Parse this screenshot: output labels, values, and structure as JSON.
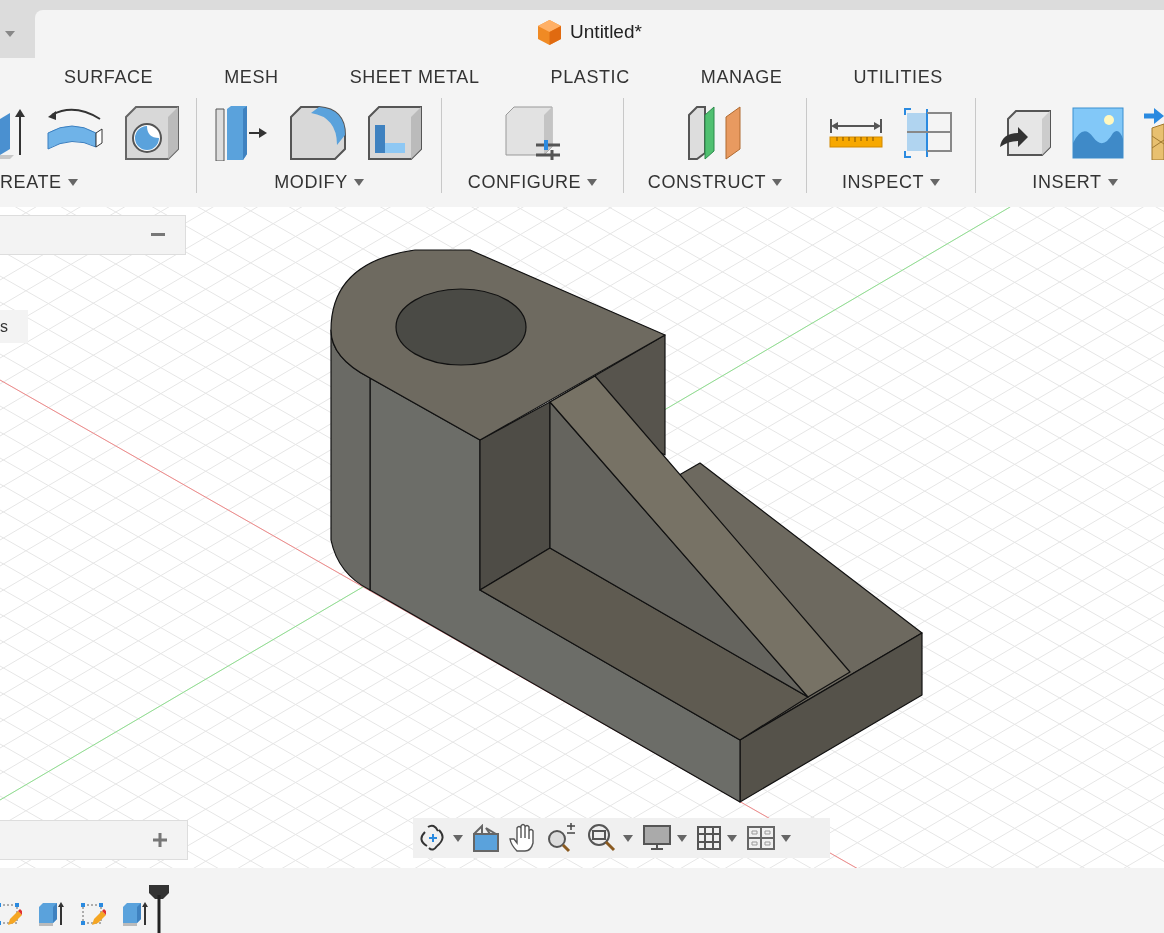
{
  "document": {
    "title": "Untitled*"
  },
  "workspace_tabs": [
    {
      "label": "SURFACE",
      "selected": false
    },
    {
      "label": "MESH",
      "selected": false
    },
    {
      "label": "SHEET METAL",
      "selected": false
    },
    {
      "label": "PLASTIC",
      "selected": false
    },
    {
      "label": "MANAGE",
      "selected": false
    },
    {
      "label": "UTILITIES",
      "selected": false
    }
  ],
  "tool_groups": [
    {
      "label": "REATE",
      "tools": [
        {
          "kind": "extrude"
        },
        {
          "kind": "revolve"
        },
        {
          "kind": "hole"
        }
      ]
    },
    {
      "label": "MODIFY",
      "tools": [
        {
          "kind": "press-pull"
        },
        {
          "kind": "fillet"
        },
        {
          "kind": "shell"
        }
      ]
    },
    {
      "label": "CONFIGURE",
      "tools": [
        {
          "kind": "configure"
        }
      ]
    },
    {
      "label": "CONSTRUCT",
      "tools": [
        {
          "kind": "plane"
        }
      ]
    },
    {
      "label": "INSPECT",
      "tools": [
        {
          "kind": "measure"
        },
        {
          "kind": "section"
        }
      ]
    },
    {
      "label": "INSERT",
      "tools": [
        {
          "kind": "derive"
        },
        {
          "kind": "image"
        },
        {
          "kind": "mesh"
        }
      ]
    }
  ],
  "browser_item": {
    "label": "s"
  },
  "nav_toolbar": [
    {
      "kind": "orbit",
      "dropdown": true
    },
    {
      "kind": "look-at",
      "dropdown": false
    },
    {
      "kind": "pan",
      "dropdown": false
    },
    {
      "kind": "zoom",
      "dropdown": false
    },
    {
      "kind": "fit",
      "dropdown": true
    },
    {
      "kind": "display",
      "dropdown": true
    },
    {
      "kind": "grid",
      "dropdown": true
    },
    {
      "kind": "viewports",
      "dropdown": true
    }
  ],
  "timeline": {
    "steps": [
      {
        "kind": "sketch"
      },
      {
        "kind": "extrude"
      },
      {
        "kind": "sketch"
      },
      {
        "kind": "extrude"
      }
    ]
  }
}
